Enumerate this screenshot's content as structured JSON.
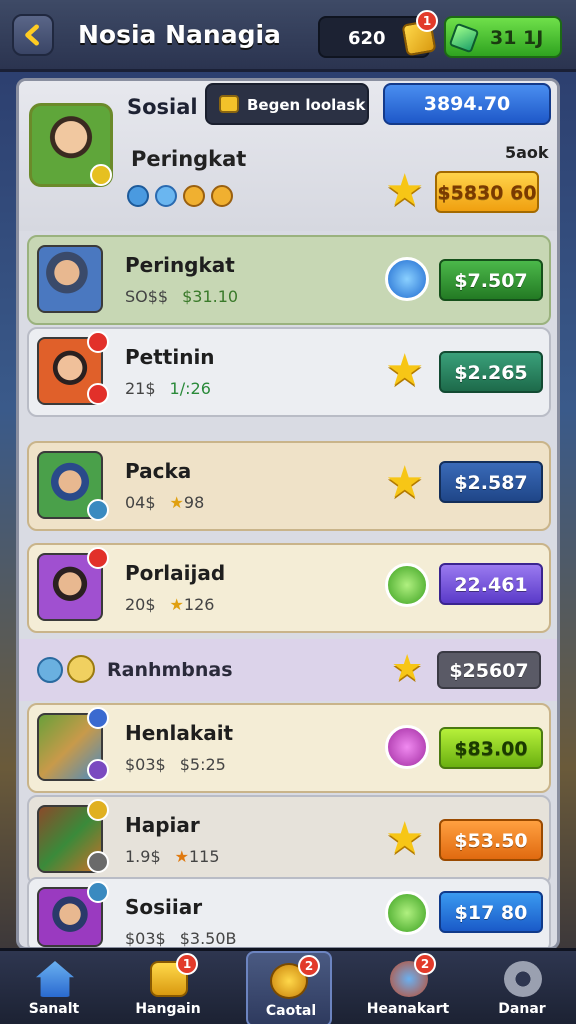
{
  "header": {
    "title": "Nosia Nanagia",
    "currency_a": "620",
    "currency_a_badge": "1",
    "currency_b": "31 1J"
  },
  "panel": {
    "section_title": "Sosial",
    "pill_text": "Begen loolask",
    "score": "3894.70",
    "rank_title": "Peringkat",
    "rank_small": "5aok",
    "rank_price": "$5830 60"
  },
  "rows": [
    {
      "name": "Peringkat",
      "sub1": "SO$$",
      "sub2": "$31.10",
      "price": "$7.507"
    },
    {
      "name": "Pettinin",
      "sub1": "21$",
      "sub2": "1/:26",
      "price": "$2.265"
    },
    {
      "name": "Packa",
      "sub1": "04$",
      "sub2": "98",
      "price": "$2.587"
    },
    {
      "name": "Porlaijad",
      "sub1": "20$",
      "sub2": "126",
      "price": "22.461"
    }
  ],
  "section": {
    "label": "Ranhmbnas",
    "price": "$25607"
  },
  "rows2": [
    {
      "name": "Henlakait",
      "sub1": "$03$",
      "sub2": "$5:25",
      "price": "$83.00"
    },
    {
      "name": "Hapiar",
      "sub1": "1.9$",
      "sub2": "115",
      "price": "$53.50"
    },
    {
      "name": "Sosiiar",
      "sub1": "$03$",
      "sub2": "$3.50B",
      "price": "$17 80"
    }
  ],
  "nav": [
    {
      "label": "Sanalt",
      "badge": ""
    },
    {
      "label": "Hangain",
      "badge": "1"
    },
    {
      "label": "Caotal",
      "badge": "2"
    },
    {
      "label": "Heanakart",
      "badge": "2"
    },
    {
      "label": "Danar",
      "badge": ""
    }
  ]
}
